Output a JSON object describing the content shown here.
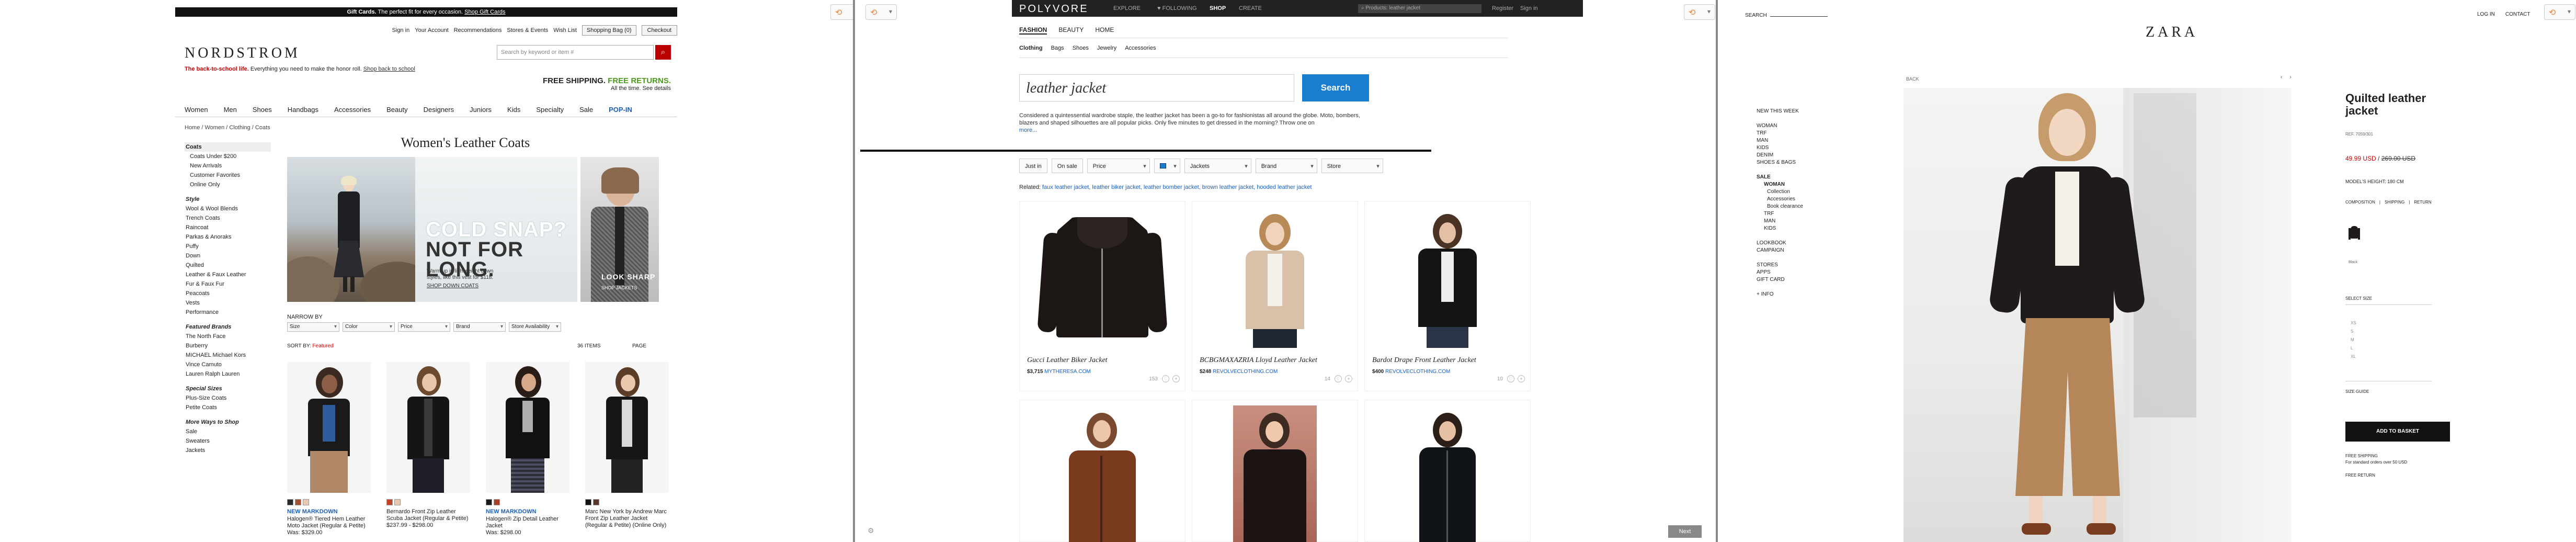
{
  "nordstrom": {
    "promo": {
      "bold": "Gift Cards.",
      "text": " The perfect fit for every occasion. ",
      "link": "Shop Gift Cards"
    },
    "utility": [
      "Sign in",
      "Your Account",
      "Recommendations",
      "Stores & Events",
      "Wish List"
    ],
    "bag": "Shopping Bag (0)",
    "checkout": "Checkout",
    "logo": "NORDSTROM",
    "search_placeholder": "Search by keyword or item #",
    "b2s_red": "The back-to-school life.",
    "b2s_text": " Everything you need to make the honor roll. ",
    "b2s_link": "Shop back to school",
    "free_a": "FREE SHIPPING.",
    "free_b": " FREE RETURNS.",
    "free_sub": "All the time. See details",
    "nav": [
      "Women",
      "Men",
      "Shoes",
      "Handbags",
      "Accessories",
      "Beauty",
      "Designers",
      "Juniors",
      "Kids",
      "Specialty",
      "Sale",
      "POP-IN"
    ],
    "breadcrumb": "Home / Women / Clothing / Coats",
    "side_head": "Coats",
    "side_sub": [
      "Coats Under $200",
      "New Arrivals",
      "Customer Favorites",
      "Online Only"
    ],
    "style_head": "Style",
    "styles": [
      "Wool & Wool Blends",
      "Trench Coats",
      "Raincoat",
      "Parkas & Anoraks",
      "Puffy",
      "Down",
      "Quilted",
      "Leather & Faux Leather",
      "Fur & Faux Fur",
      "Peacoats",
      "Vests",
      "Performance"
    ],
    "brands_head": "Featured Brands",
    "brands": [
      "The North Face",
      "Burberry",
      "MICHAEL Michael Kors",
      "Vince Camuto",
      "Lauren Ralph Lauren"
    ],
    "sizes_head": "Special Sizes",
    "sizes": [
      "Plus-Size Coats",
      "Petite Coats"
    ],
    "more_head": "More Ways to Shop",
    "more": [
      "Sale",
      "Sweaters",
      "Jackets"
    ],
    "title": "Women's Leather Coats",
    "hero_a": "COLD SNAP?",
    "hero_b": "NOT FOR LONG.",
    "hero_small": "Warm up in lightweight down styles, like this vest for $118.",
    "hero_shop": "SHOP DOWN COATS",
    "side2_a": "LOOK SHARP",
    "side2_b": "SHOP JACKETS",
    "narrow_by": "NARROW BY",
    "filters": [
      "Size",
      "Color",
      "Price",
      "Brand",
      "Store Availability"
    ],
    "sort_label": "SORT BY:",
    "sort_value": "Featured",
    "items": "36 ITEMS",
    "page": "PAGE",
    "products": [
      {
        "mk": "NEW MARKDOWN",
        "name": "Halogen® Tiered Hem Leather Moto Jacket (Regular & Petite)",
        "price": "Was: $329.00"
      },
      {
        "mk": "",
        "name": "Bernardo Front Zip Leather Scuba Jacket (Regular & Petite)",
        "price": "$237.99 - $298.00"
      },
      {
        "mk": "NEW MARKDOWN",
        "name": "Halogen® Zip Detail Leather Jacket",
        "price": "Was: $298.00"
      },
      {
        "mk": "",
        "name": "Marc New York by Andrew Marc Front Zip Leather Jacket (Regular & Petite) (Online Only)",
        "price": ""
      }
    ]
  },
  "polyvore": {
    "logo": "POLYVORE",
    "nav": [
      "EXPLORE",
      "FOLLOWING",
      "SHOP",
      "CREATE"
    ],
    "search_placeholder": "Products: leather jacket",
    "register": "Register",
    "signin": "Sign in",
    "sub": [
      "FASHION",
      "BEAUTY",
      "HOME"
    ],
    "sub2": [
      "Clothing",
      "Bags",
      "Shoes",
      "Jewelry",
      "Accessories"
    ],
    "query": "leather jacket",
    "search_btn": "Search",
    "desc": "Considered a quintessential wardrobe staple, the leather jacket has been a go-to for fashionistas all around the globe. Moto, bombers, blazers and shaped silhouettes are all popular picks. Only five minutes to get dressed in the morning? Throw one on",
    "more": "more...",
    "filters": [
      "Just in",
      "On sale",
      "Price",
      "",
      "Jackets",
      "Brand",
      "Store"
    ],
    "related_label": "Related: ",
    "related": "faux leather jacket, leather biker jacket, leather bomber jacket, brown leather jacket, hooded leather jacket",
    "cards": [
      {
        "name": "Gucci Leather Biker Jacket",
        "price": "$3,715",
        "store": "MYTHERESA.COM",
        "likes": "153"
      },
      {
        "name": "BCBGMAXAZRIA Lloyd Leather Jacket",
        "price": "$248",
        "store": "REVOLVECLOTHING.COM",
        "likes": "14"
      },
      {
        "name": "Bardot Drape Front Leather Jacket",
        "price": "$400",
        "store": "REVOLVECLOTHING.COM",
        "likes": "10"
      }
    ],
    "next": "Next"
  },
  "zara": {
    "search": "SEARCH",
    "login": "LOG IN",
    "contact": "CONTACT",
    "logo": "ZARA",
    "back": "BACK",
    "menu": {
      "new": "NEW THIS WEEK",
      "cats": [
        "WOMAN",
        "TRF",
        "MAN",
        "KIDS",
        "DENIM",
        "SHOES & BAGS"
      ],
      "sale": "SALE",
      "sale_woman": "WOMAN",
      "sale_sub": [
        "Collection",
        "Accessories",
        "Book clearance"
      ],
      "sale_more": [
        "TRF",
        "MAN",
        "KIDS"
      ],
      "lookbook": "LOOKBOOK",
      "campaign": "CAMPAIGN",
      "stores": [
        "STORES",
        "APPS",
        "GIFT CARD"
      ],
      "info": "+ INFO"
    },
    "title": "Quilted leather jacket",
    "ref": "REF. 7059/301",
    "price_new": "49.99 USD",
    "price_old": "269.00 USD",
    "model": "MODEL'S HEIGHT: 180 CM",
    "links": [
      "COMPOSITION",
      "SHIPPING",
      "RETURN"
    ],
    "color": "Black",
    "select_size": "SELECT SIZE",
    "sizes": [
      "XS",
      "S",
      "M",
      "L",
      "XL"
    ],
    "size_guide": "SIZE GUIDE",
    "add": "ADD TO BASKET",
    "ship_a": "FREE SHIPPING",
    "ship_b": "For standard orders over 50 USD",
    "free_return": "FREE RETURN"
  }
}
